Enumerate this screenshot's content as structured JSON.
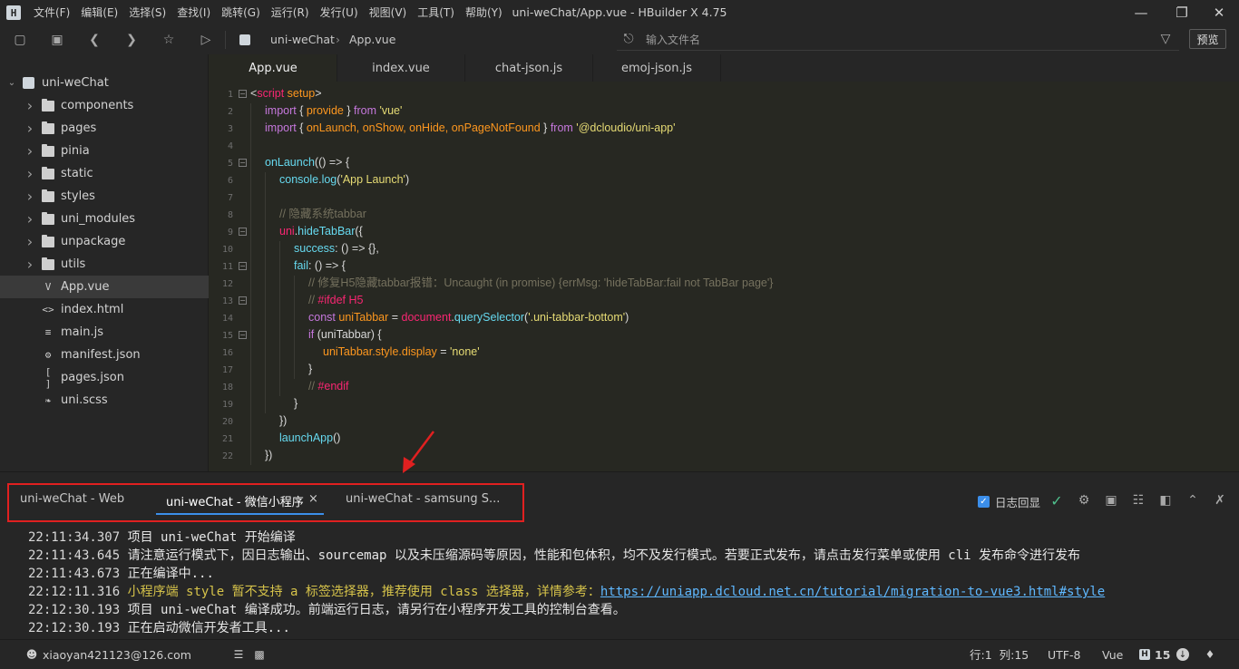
{
  "window": {
    "title": "uni-weChat/App.vue - HBuilder X 4.75",
    "menu": [
      "文件(F)",
      "编辑(E)",
      "选择(S)",
      "查找(I)",
      "跳转(G)",
      "运行(R)",
      "发行(U)",
      "视图(V)",
      "工具(T)",
      "帮助(Y)"
    ],
    "logo_letter": "H"
  },
  "toolbar": {
    "breadcrumb_project": "uni-weChat",
    "breadcrumb_file": "App.vue",
    "search_placeholder": "输入文件名",
    "preview_label": "预览"
  },
  "sidebar": {
    "project": "uni-weChat",
    "items": [
      {
        "label": "components",
        "type": "folder"
      },
      {
        "label": "pages",
        "type": "folder"
      },
      {
        "label": "pinia",
        "type": "folder"
      },
      {
        "label": "static",
        "type": "folder"
      },
      {
        "label": "styles",
        "type": "folder"
      },
      {
        "label": "uni_modules",
        "type": "folder"
      },
      {
        "label": "unpackage",
        "type": "folder"
      },
      {
        "label": "utils",
        "type": "folder"
      },
      {
        "label": "App.vue",
        "type": "vue-file",
        "selected": true
      },
      {
        "label": "index.html",
        "type": "html-file"
      },
      {
        "label": "main.js",
        "type": "js-file"
      },
      {
        "label": "manifest.json",
        "type": "manifest-file"
      },
      {
        "label": "pages.json",
        "type": "json-file"
      },
      {
        "label": "uni.scss",
        "type": "scss-file"
      }
    ]
  },
  "editor_tabs": [
    "App.vue",
    "index.vue",
    "chat-json.js",
    "emoj-json.js"
  ],
  "code": {
    "line_numbers": [
      "1",
      "2",
      "3",
      "4",
      "5",
      "6",
      "7",
      "8",
      "9",
      "10",
      "11",
      "12",
      "13",
      "14",
      "15",
      "16",
      "17",
      "18",
      "19",
      "20",
      "21",
      "22"
    ],
    "l1_lt": "<",
    "l1_tag": "script",
    "l1_attr": " setup",
    "l1_gt": ">",
    "l2_import": "import",
    "l2_a": " { ",
    "l2_provide": "provide",
    "l2_b": " } ",
    "l2_from": "from",
    "l2_str": " 'vue'",
    "l3_import": "import",
    "l3_a": " { ",
    "l3_names": "onLaunch, onShow, onHide, onPageNotFound",
    "l3_b": " } ",
    "l3_from": "from",
    "l3_str": " '@dcloudio/uni-app'",
    "l5_fn": "onLaunch",
    "l5_rest": "(() => {",
    "l6_console": "console",
    "l6_dot": ".",
    "l6_log": "log",
    "l6_open": "(",
    "l6_str": "'App Launch'",
    "l6_close": ")",
    "l8_comment": "// 隐藏系统tabbar",
    "l9_uni": "uni",
    "l9_dot": ".",
    "l9_fn": "hideTabBar",
    "l9_rest": "({",
    "l10_key": "success",
    "l10_rest": ": () => {},",
    "l11_key": "fail",
    "l11_rest": ": () => {",
    "l12_comment": "// 修复H5隐藏tabbar报错：Uncaught (in promise) {errMsg: 'hideTabBar:fail not TabBar page'}",
    "l13_comment": "// ",
    "l13_directive": "#ifdef",
    "l13_target": " H5",
    "l14_const": "const",
    "l14_var": " uniTabbar",
    "l14_eq": " = ",
    "l14_doc": "document",
    "l14_dot": ".",
    "l14_fn": "querySelector",
    "l14_open": "(",
    "l14_str": "'.uni-tabbar-bottom'",
    "l14_close": ")",
    "l15_if": "if",
    "l15_rest": " (uniTabbar) {",
    "l16_var": "uniTabbar",
    "l16_chain": ".style.display",
    "l16_eq": " = ",
    "l16_str": "'none'",
    "l17": "}",
    "l18_comment": "// ",
    "l18_directive": "#endif",
    "l19": "}",
    "l20": "})",
    "l21_fn": "launchApp",
    "l21_rest": "()",
    "l22": "})"
  },
  "console": {
    "tabs": [
      "uni-weChat - Web",
      "uni-weChat - 微信小程序",
      "uni-weChat - samsung S..."
    ],
    "active_tab_close": "×",
    "log_echo_label": "日志回显",
    "lines": [
      {
        "time": "22:11:34.307",
        "text": "项目 uni-weChat 开始编译"
      },
      {
        "time": "22:11:43.645",
        "text": "请注意运行模式下，因日志输出、sourcemap 以及未压缩源码等原因，性能和包体积，均不及发行模式。若要正式发布，请点击发行菜单或使用 cli 发布命令进行发布"
      },
      {
        "time": "22:11:43.673",
        "text": "正在编译中..."
      },
      {
        "time": "22:12:11.316",
        "text": "小程序端 style 暂不支持 a 标签选择器，推荐使用 class 选择器，详情参考：",
        "link": "https://uniapp.dcloud.net.cn/tutorial/migration-to-vue3.html#style"
      },
      {
        "time": "22:12:30.193",
        "text": "项目 uni-weChat 编译成功。前端运行日志，请另行在小程序开发工具的控制台查看。"
      },
      {
        "time": "22:12:30.193",
        "text": "正在启动微信开发者工具..."
      }
    ]
  },
  "statusbar": {
    "user": "xiaoyan421123@126.com",
    "position": "行:1  列:15",
    "encoding": "UTF-8",
    "language": "Vue",
    "notifications_count": "15"
  },
  "colors": {
    "accent": "#3b8eea",
    "annotation_red": "#e02020",
    "warning_text": "#d6c34a"
  }
}
